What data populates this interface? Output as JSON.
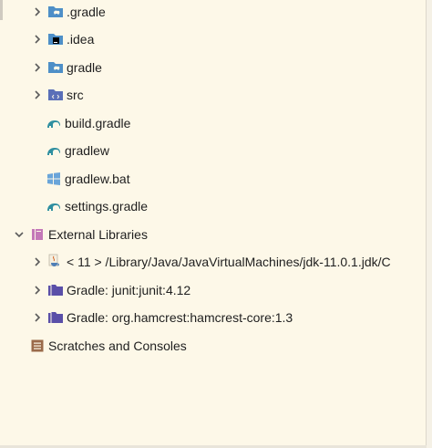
{
  "project_tree": {
    "items": [
      {
        "label": ".gradle",
        "icon": "folder-gradle-icon"
      },
      {
        "label": ".idea",
        "icon": "folder-idea-icon"
      },
      {
        "label": "gradle",
        "icon": "folder-gradle-icon"
      },
      {
        "label": "src",
        "icon": "source-folder-icon"
      },
      {
        "label": "build.gradle",
        "icon": "gradle-elephant-icon"
      },
      {
        "label": "gradlew",
        "icon": "gradle-elephant-icon"
      },
      {
        "label": "gradlew.bat",
        "icon": "windows-batch-icon"
      },
      {
        "label": "settings.gradle",
        "icon": "gradle-elephant-icon"
      }
    ],
    "external_libraries": {
      "label": "External Libraries",
      "icon": "library-icon",
      "children": [
        {
          "label": "< 11 >  /Library/Java/JavaVirtualMachines/jdk-11.0.1.jdk/C",
          "icon": "java-cup-icon"
        },
        {
          "label": "Gradle: junit:junit:4.12",
          "icon": "library-folder-icon"
        },
        {
          "label": "Gradle: org.hamcrest:hamcrest-core:1.3",
          "icon": "library-folder-icon"
        }
      ]
    },
    "scratches": {
      "label": "Scratches and Consoles",
      "icon": "scratches-icon"
    }
  },
  "colors": {
    "background": "#fdf8e8",
    "chevron": "#5b5b5b",
    "folder_blue": "#4e8fc7",
    "gradle_teal": "#2f8fa0",
    "library_purple": "#5a4fa8",
    "pink_library": "#c478b8",
    "scratches_brown": "#9a6a4a"
  }
}
